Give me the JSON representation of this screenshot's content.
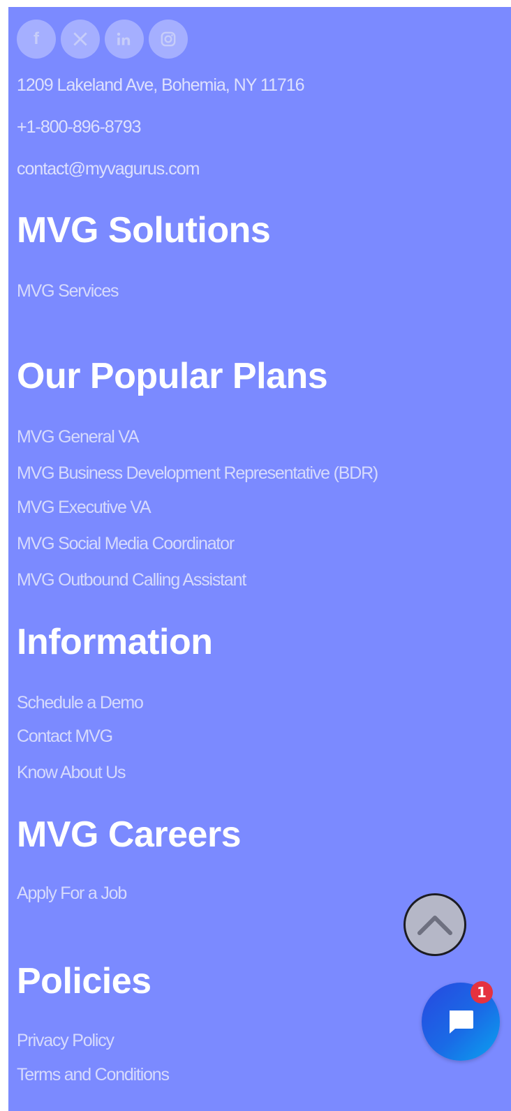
{
  "social": {
    "icons": [
      "facebook-icon",
      "x-twitter-icon",
      "linkedin-icon",
      "instagram-icon"
    ],
    "facebook_glyph": "f"
  },
  "contact": {
    "address": "1209 Lakeland Ave, Bohemia, NY 11716",
    "phone": "+1-800-896-8793",
    "email": "contact@myvagurus.com"
  },
  "solutions": {
    "heading": "MVG Solutions",
    "links": [
      "MVG Services"
    ]
  },
  "plans": {
    "heading": "Our Popular Plans",
    "links": [
      "MVG General VA",
      "MVG Business Development Representative (BDR)",
      "MVG Executive VA",
      "MVG Social Media Coordinator",
      "MVG Outbound Calling Assistant"
    ]
  },
  "information": {
    "heading": "Information",
    "links": [
      "Schedule a Demo",
      "Contact MVG",
      "Know About Us"
    ]
  },
  "careers": {
    "heading": "MVG Careers",
    "links": [
      "Apply For a Job"
    ]
  },
  "policies": {
    "heading": "Policies",
    "links": [
      "Privacy Policy",
      "Terms and Conditions"
    ]
  },
  "chat": {
    "badge_count": "1"
  },
  "colors": {
    "footer_bg": "#7b8aff",
    "chat_gradient_start": "#2748e0",
    "chat_gradient_end": "#0aa3f0",
    "badge": "#e5323f"
  }
}
